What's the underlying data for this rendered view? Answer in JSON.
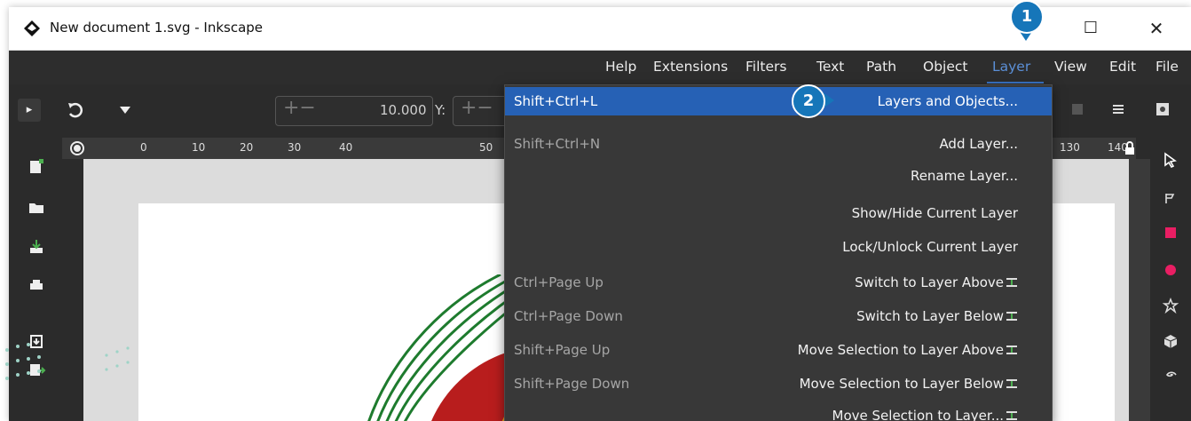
{
  "window": {
    "title": "New document 1.svg - Inkscape",
    "maximize_glyph": "☐",
    "close_glyph": "✕"
  },
  "menubar": {
    "items": [
      {
        "label": "Help"
      },
      {
        "label": "Extensions"
      },
      {
        "label": "Filters"
      },
      {
        "label": "Text"
      },
      {
        "label": "Path"
      },
      {
        "label": "Object"
      },
      {
        "label": "Layer",
        "active": true
      },
      {
        "label": "View"
      },
      {
        "label": "Edit"
      },
      {
        "label": "File"
      }
    ]
  },
  "toolbar": {
    "x_value": "10.000",
    "y_label": "Y:"
  },
  "ruler": {
    "ticks": [
      "0",
      "10",
      "20",
      "30",
      "40",
      "50",
      "130",
      "140"
    ]
  },
  "layer_menu": {
    "items": [
      {
        "shortcut": "Shift+Ctrl+L",
        "label": "Layers and Objects...",
        "selected": true
      },
      {
        "shortcut": "Shift+Ctrl+N",
        "label": "Add Layer..."
      },
      {
        "shortcut": "",
        "label": "Rename Layer..."
      },
      {
        "shortcut": "",
        "label": "Show/Hide Current Layer"
      },
      {
        "shortcut": "",
        "label": "Lock/Unlock Current Layer"
      },
      {
        "shortcut": "Ctrl+Page Up",
        "label": "Switch to Layer Above"
      },
      {
        "shortcut": "Ctrl+Page Down",
        "label": "Switch to Layer Below"
      },
      {
        "shortcut": "Shift+Page Up",
        "label": "Move Selection to Layer Above"
      },
      {
        "shortcut": "Shift+Page Down",
        "label": "Move Selection to Layer Below"
      },
      {
        "shortcut": "",
        "label": "Move Selection to Layer..."
      }
    ]
  },
  "callouts": {
    "one": "1",
    "two": "2"
  },
  "colors": {
    "accent": "#2661b5",
    "callout": "#1676b9"
  }
}
